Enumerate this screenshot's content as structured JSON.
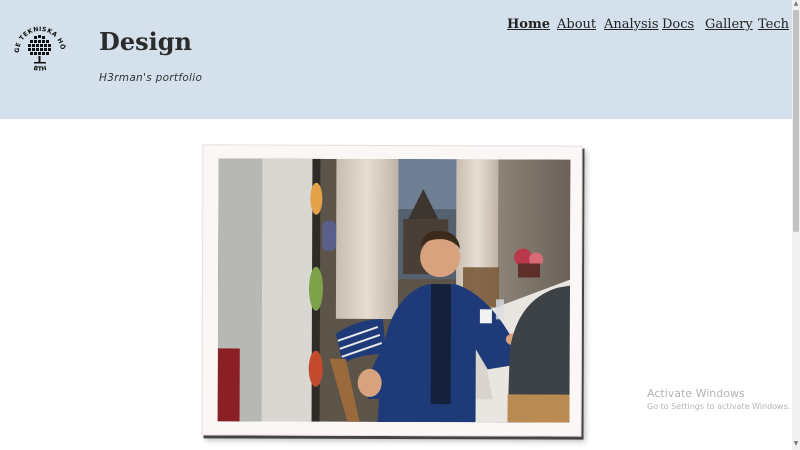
{
  "header": {
    "title": "Design",
    "subtitle": "H3rman's portfolio",
    "logo": {
      "icon": "bth-seal-logo",
      "text": "BLEKINGE TEKNISKA HÖGSKOLA · BTH"
    }
  },
  "nav": {
    "items": [
      {
        "label": "Home",
        "active": true
      },
      {
        "label": "About",
        "active": false
      },
      {
        "label": "Analysis",
        "active": false
      },
      {
        "label": "Docs",
        "active": false
      },
      {
        "label": "Gallery",
        "active": false
      },
      {
        "label": "Tech",
        "active": false
      }
    ]
  },
  "photo": {
    "alt": "Young man in blue track jacket sitting at a dining table"
  },
  "watermark": {
    "line1": "Activate Windows",
    "line2": "Go to Settings to activate Windows."
  },
  "colors": {
    "header_bg": "#d4e0ec",
    "text": "#222222",
    "frame": "#fbf7f7"
  }
}
